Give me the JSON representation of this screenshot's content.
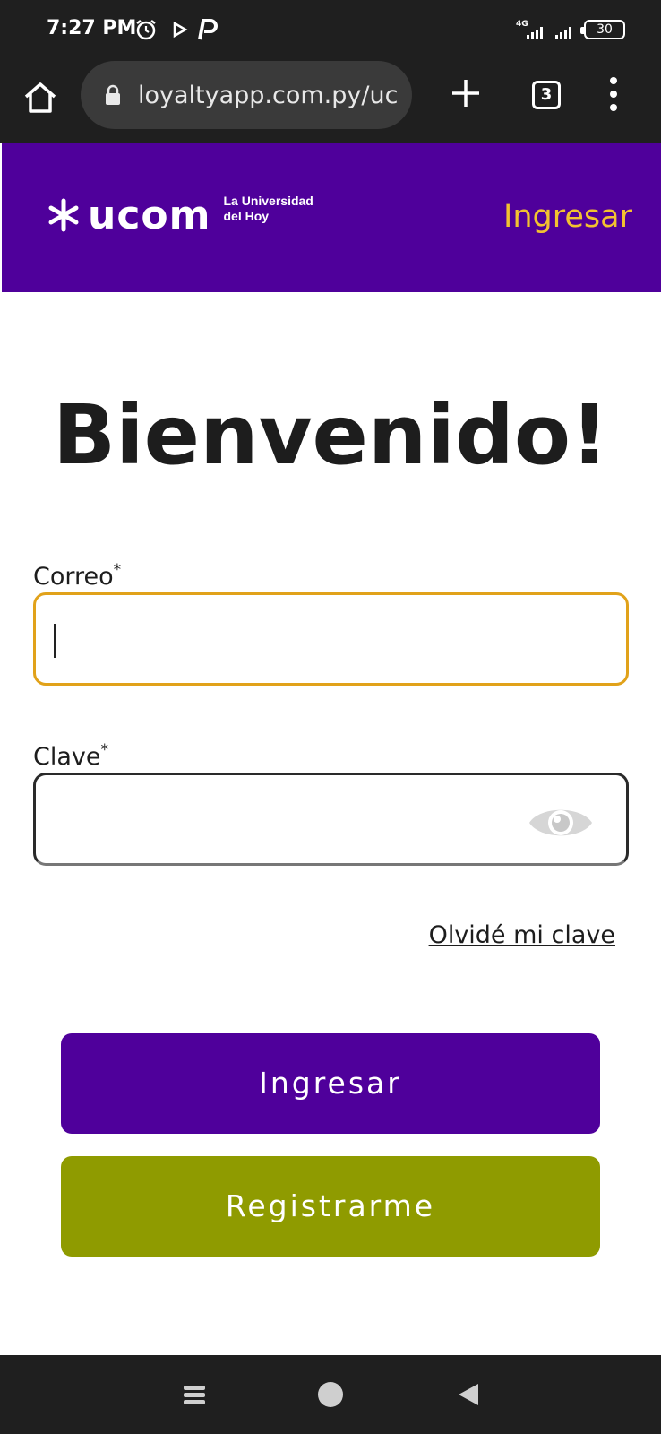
{
  "status_bar": {
    "time": "7:27 PM",
    "network": "4G",
    "battery": "30",
    "icons": [
      "alarm-icon",
      "play-icon",
      "p-app-icon",
      "signal-icon",
      "signal-icon",
      "battery-icon"
    ]
  },
  "browser": {
    "url": "loyaltyapp.com.py/uc",
    "tab_count": "3",
    "icons": [
      "home-icon",
      "lock-icon",
      "plus-icon",
      "tabs-icon",
      "more-vert-icon"
    ]
  },
  "header": {
    "logo_word": "ucom",
    "logo_tagline_1": "La Universidad",
    "logo_tagline_2": "del Hoy",
    "login_link": "Ingresar",
    "background": "#4f009b",
    "login_link_color": "#f2c230"
  },
  "main": {
    "title": "Bienvenido!",
    "email_label": "Correo",
    "email_required": "*",
    "email_value": "",
    "password_label": "Clave",
    "password_required": "*",
    "password_value": "",
    "forgot_link": "Olvidé mi clave",
    "login_button": "Ingresar",
    "register_button": "Registrarme",
    "login_button_color": "#4f009b",
    "register_button_color": "#8f9b00",
    "focus_border_color": "#e1a21a"
  }
}
